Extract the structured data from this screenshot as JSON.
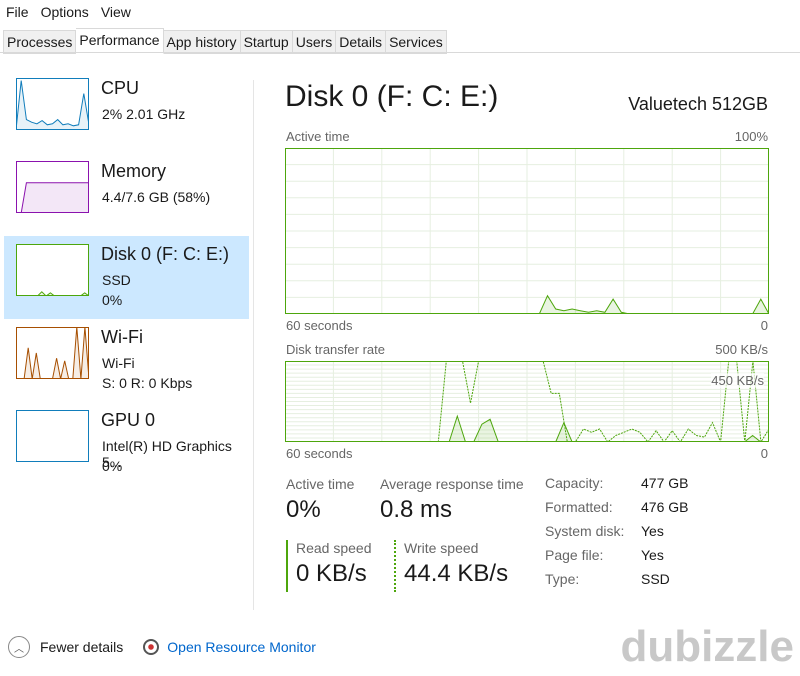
{
  "menu": [
    "File",
    "Options",
    "View"
  ],
  "tabs": [
    {
      "label": "Processes"
    },
    {
      "label": "Performance",
      "active": true
    },
    {
      "label": "App history"
    },
    {
      "label": "Startup"
    },
    {
      "label": "Users"
    },
    {
      "label": "Details"
    },
    {
      "label": "Services"
    }
  ],
  "sidebar": [
    {
      "title": "CPU",
      "line1": "2%  2.01 GHz",
      "line2": "",
      "color": "#117dbb",
      "spark": [
        0,
        95,
        20,
        15,
        12,
        18,
        10,
        12,
        20,
        10,
        12,
        8,
        10,
        70,
        10
      ]
    },
    {
      "title": "Memory",
      "line1": "4.4/7.6 GB (58%)",
      "line2": "",
      "color": "#8b12ae",
      "spark": [
        0,
        0,
        58,
        58,
        58,
        58,
        58,
        58,
        58,
        58,
        58,
        58,
        58,
        58,
        58
      ]
    },
    {
      "title": "Disk 0 (F: C: E:)",
      "line1": "SSD",
      "line2": "0%",
      "color": "#4da60c",
      "selected": true,
      "spark": [
        0,
        0,
        0,
        0,
        0,
        0,
        8,
        0,
        6,
        0,
        0,
        0,
        0,
        0,
        0,
        0,
        6,
        0
      ]
    },
    {
      "title": "Wi-Fi",
      "line1": "Wi-Fi",
      "line2": "S: 0  R: 0 Kbps",
      "color": "#a74f01",
      "spark": [
        0,
        0,
        0,
        60,
        0,
        50,
        0,
        0,
        0,
        0,
        40,
        0,
        35,
        0,
        0,
        100,
        0,
        100,
        0
      ]
    },
    {
      "title": "GPU 0",
      "line1": "Intel(R) HD Graphics 5...",
      "line2": "0%",
      "color": "#117dbb",
      "spark": [
        0,
        0,
        0,
        0,
        0,
        0,
        0,
        0,
        0,
        0,
        0,
        0,
        0,
        0
      ]
    }
  ],
  "main": {
    "title": "Disk 0 (F: C: E:)",
    "model": "Valuetech 512GB",
    "active_label": "Active time",
    "active_max": "100%",
    "time_label": "60 seconds",
    "zero": "0",
    "rate_label": "Disk transfer rate",
    "rate_max": "500 KB/s",
    "rate_mid": "450 KB/s",
    "stats": {
      "active_time_label": "Active time",
      "active_time": "0%",
      "resp_label": "Average response time",
      "resp": "0.8 ms",
      "read_label": "Read speed",
      "read": "0 KB/s",
      "write_label": "Write speed",
      "write": "44.4 KB/s"
    },
    "props": [
      [
        "Capacity:",
        "477 GB"
      ],
      [
        "Formatted:",
        "476 GB"
      ],
      [
        "System disk:",
        "Yes"
      ],
      [
        "Page file:",
        "Yes"
      ],
      [
        "Type:",
        "SSD"
      ]
    ]
  },
  "chart_data": [
    {
      "type": "area",
      "title": "Active time",
      "ylim": [
        0,
        100
      ],
      "xlabel": "60 seconds",
      "values": [
        0,
        0,
        0,
        0,
        0,
        0,
        0,
        0,
        0,
        0,
        0,
        0,
        0,
        0,
        0,
        0,
        0,
        0,
        0,
        0,
        0,
        0,
        0,
        0,
        0,
        0,
        0,
        0,
        0,
        0,
        0,
        0,
        11,
        3,
        2,
        3,
        2,
        1,
        2,
        1,
        9,
        1,
        0,
        0,
        0,
        0,
        0,
        0,
        0,
        0,
        0,
        0,
        0,
        0,
        0,
        0,
        0,
        0,
        9,
        0
      ]
    },
    {
      "type": "line",
      "title": "Disk transfer rate",
      "ylim": [
        0,
        500
      ],
      "xlabel": "60 seconds",
      "read": [
        0,
        0,
        0,
        0,
        0,
        0,
        0,
        0,
        0,
        0,
        0,
        0,
        0,
        0,
        0,
        0,
        0,
        0,
        0,
        0,
        0,
        160,
        0,
        0,
        110,
        140,
        0,
        0,
        0,
        0,
        0,
        0,
        0,
        0,
        120,
        0,
        0,
        0,
        0,
        0,
        0,
        0,
        0,
        0,
        0,
        0,
        0,
        0,
        0,
        0,
        0,
        0,
        0,
        0,
        0,
        0,
        0,
        40,
        0,
        0
      ],
      "write": [
        0,
        0,
        0,
        0,
        0,
        0,
        0,
        0,
        0,
        0,
        0,
        0,
        0,
        0,
        0,
        0,
        0,
        0,
        0,
        0,
        500,
        500,
        500,
        240,
        500,
        500,
        500,
        500,
        500,
        500,
        500,
        500,
        500,
        300,
        300,
        0,
        0,
        80,
        60,
        80,
        0,
        40,
        60,
        80,
        60,
        0,
        70,
        0,
        70,
        0,
        80,
        40,
        30,
        120,
        0,
        500,
        500,
        0,
        500,
        0,
        80
      ]
    }
  ],
  "footer": {
    "fewer": "Fewer details",
    "monitor": "Open Resource Monitor"
  },
  "watermark": "dubizzle",
  "colors": {
    "disk": "#4da60c",
    "selected": "#cce8ff",
    "link": "#0066cc"
  }
}
